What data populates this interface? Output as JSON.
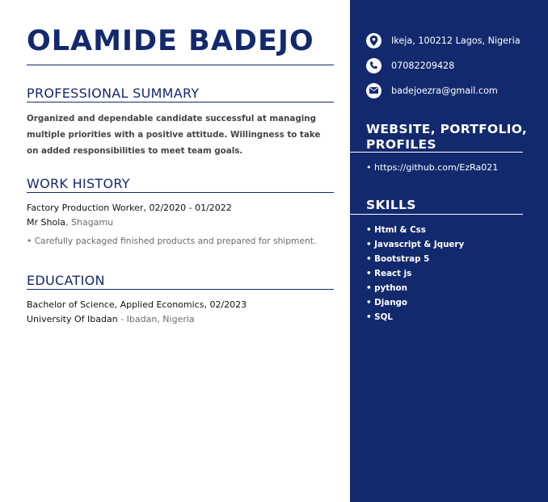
{
  "name": "OLAMIDE BADEJO",
  "summary": {
    "title": "PROFESSIONAL SUMMARY",
    "text": "Organized and dependable candidate successful at managing multiple priorities with a positive attitude. Willingness to take on added responsibilities to meet team goals."
  },
  "work": {
    "title": "WORK HISTORY",
    "job_title": "Factory Production Worker",
    "dates": ", 02/2020 - 01/2022",
    "employer": "Mr Shola",
    "location": ", Shagamu",
    "bullet": "• Carefully packaged finished products and prepared for shipment."
  },
  "education": {
    "title": "EDUCATION",
    "degree": "Bachelor of Science, Applied Economics",
    "date": ", 02/2023",
    "school": "University Of Ibadan",
    "location": " - Ibadan, Nigeria"
  },
  "contact": {
    "address": "Ikeja, 100212 Lagos, Nigeria",
    "phone": "07082209428",
    "email": "badejoezra@gmail.com",
    "address_icon": "location-pin-icon",
    "phone_icon": "phone-icon",
    "email_icon": "envelope-icon"
  },
  "links": {
    "title": "WEBSITE, PORTFOLIO, PROFILES",
    "item": "• https://github.com/EzRa021"
  },
  "skills": {
    "title": "SKILLS",
    "items": [
      "• Html & Css",
      "• Javascript & Jquery",
      "• Bootstrap 5",
      "• React js",
      "• python",
      "• Django",
      "• SQL"
    ]
  },
  "colors": {
    "accent": "#13296e",
    "sidebar_text": "#ffffff",
    "muted_text": "#6b6b6b"
  }
}
